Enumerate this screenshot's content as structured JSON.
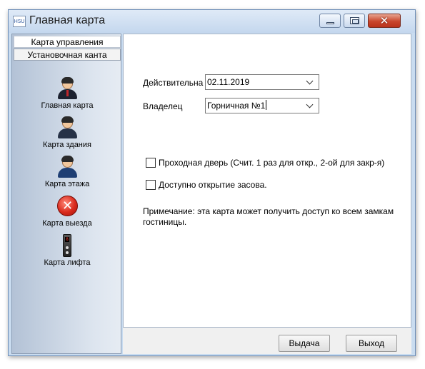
{
  "window": {
    "app_icon_text": "HSU",
    "title": "Главная карта"
  },
  "sidebar": {
    "tabs": [
      {
        "label": "Карта управления",
        "active": true
      },
      {
        "label": "Установочная канта",
        "active": false
      }
    ],
    "items": [
      {
        "label": "Главная карта",
        "icon": "person-red-tie-icon"
      },
      {
        "label": "Карта здания",
        "icon": "person-icon"
      },
      {
        "label": "Карта этажа",
        "icon": "person-icon"
      },
      {
        "label": "Карта выезда",
        "icon": "red-x-circle-icon"
      },
      {
        "label": "Карта лифта",
        "icon": "elevator-icon"
      }
    ]
  },
  "form": {
    "valid_label": "Действительна",
    "valid_value": "02.11.2019",
    "owner_label": "Владелец",
    "owner_value": "Горничная №1",
    "checkbox_passage": {
      "label": "Проходная дверь (Счит. 1 раз для откр., 2-ой для закр-я)",
      "checked": false
    },
    "checkbox_deadbolt": {
      "label": "Доступно открытие засова.",
      "checked": false
    },
    "note": "Примечание: эта карта может получить доступ ко всем замкам гостиницы."
  },
  "footer": {
    "issue_label": "Выдача",
    "exit_label": "Выход"
  },
  "colors": {
    "window_frame": "#c9dcf0",
    "close_button": "#c9462c",
    "sidebar_gradient_start": "#b3c2d6"
  }
}
